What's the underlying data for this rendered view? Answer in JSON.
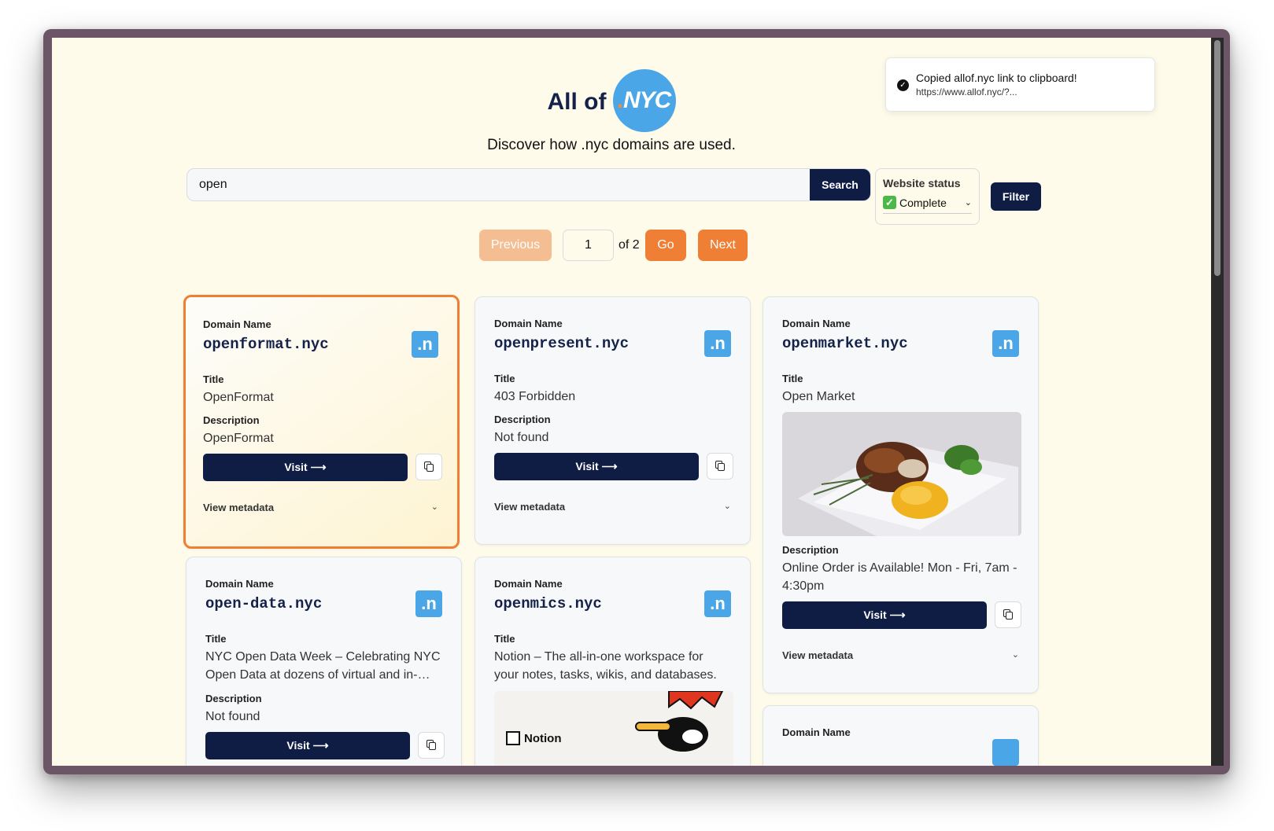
{
  "header": {
    "logo_text": "All of",
    "logo_badge": "NYC",
    "logo_dot": ".",
    "tagline": "Discover how .nyc domains are used."
  },
  "search": {
    "value": "open",
    "button_label": "Search"
  },
  "status_filter": {
    "label": "Website status",
    "selected": "Complete",
    "filter_label": "Filter"
  },
  "pagination": {
    "previous_label": "Previous",
    "page_value": "1",
    "of_text": "of 2",
    "go_label": "Go",
    "next_label": "Next"
  },
  "toast": {
    "title": "Copied allof.nyc link to clipboard!",
    "subtitle": "https://www.allof.nyc/?..."
  },
  "card_labels": {
    "domain_name": "Domain Name",
    "title": "Title",
    "description": "Description",
    "visit": "Visit ⟶",
    "view_metadata": "View metadata",
    "badge": ".n"
  },
  "cards": [
    {
      "domain": "openformat.nyc",
      "title": "OpenFormat",
      "description": "OpenFormat"
    },
    {
      "domain": "openpresent.nyc",
      "title": "403 Forbidden",
      "description": "Not found"
    },
    {
      "domain": "openmarket.nyc",
      "title": "Open Market",
      "description": "Online Order is Available! Mon - Fri, 7am - 4:30pm"
    },
    {
      "domain": "open-data.nyc",
      "title": "NYC Open Data Week – Celebrating NYC Open Data at dozens of virtual and in-…",
      "description": "Not found"
    },
    {
      "domain": "openmics.nyc",
      "title": "Notion – The all-in-one workspace for your notes, tasks, wikis, and databases.",
      "thumb_text": "Notion"
    },
    {
      "domain_label_only": "Domain Name"
    }
  ],
  "colors": {
    "page_bg": "#fefbea",
    "navy": "#0f1d45",
    "orange": "#ef7f34",
    "blue": "#4aa6e6"
  }
}
